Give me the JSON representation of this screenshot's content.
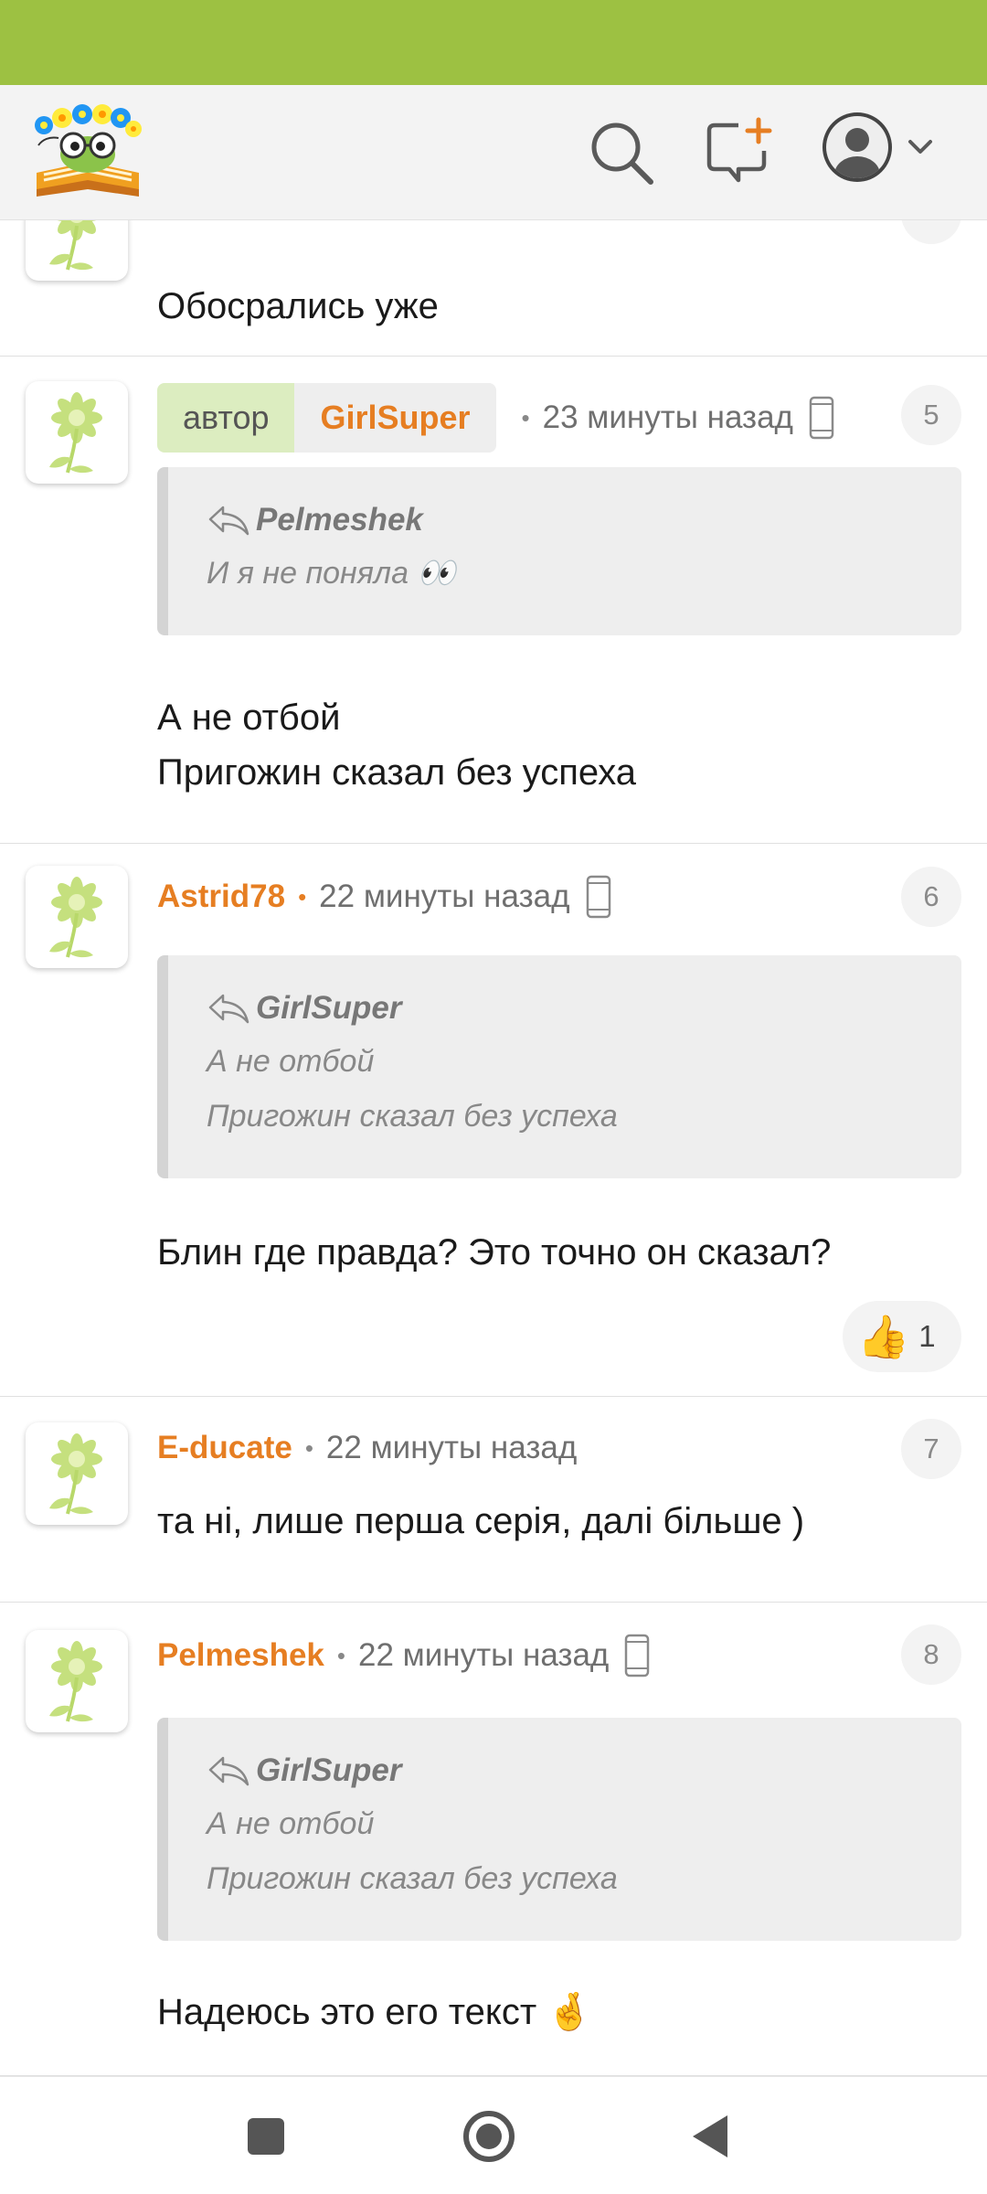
{
  "app": {
    "colors": {
      "brand_green": "#9dc142",
      "accent_orange": "#e67e22"
    },
    "icons": [
      "logo",
      "search-icon",
      "new-topic-icon",
      "profile-icon",
      "chevron-down-icon"
    ]
  },
  "comments": [
    {
      "number": "",
      "text": [
        "Обосрались уже"
      ]
    },
    {
      "badge_role": "автор",
      "author": "GirlSuper",
      "time": "23 минуты назад",
      "device": "phone-icon",
      "number": "5",
      "quote": {
        "author": "Pelmeshek",
        "lines": [
          "И я не поняла 👀"
        ]
      },
      "text": [
        "А не отбой",
        "Пригожин сказал без успеха"
      ]
    },
    {
      "author": "Astrid78",
      "time": "22 минуты назад",
      "device": "phone-icon",
      "number": "6",
      "quote": {
        "author": "GirlSuper",
        "lines": [
          "А не отбой",
          "Пригожин сказал без успеха"
        ]
      },
      "text": [
        "Блин где правда? Это точно он сказал?"
      ],
      "likes": {
        "emoji": "👍",
        "count": "1"
      }
    },
    {
      "author": "E-ducate",
      "time": "22 минуты назад",
      "number": "7",
      "text": [
        "та ні, лише перша серія, далі більше )"
      ]
    },
    {
      "author": "Pelmeshek",
      "time": "22 минуты назад",
      "device": "phone-icon",
      "number": "8",
      "quote": {
        "author": "GirlSuper",
        "lines": [
          "А не отбой",
          "Пригожин сказал без успеха"
        ]
      },
      "text": [
        "Надеюсь это его текст 🤞"
      ]
    }
  ],
  "nav": {
    "buttons": [
      "recents-button",
      "home-button",
      "back-button"
    ]
  }
}
